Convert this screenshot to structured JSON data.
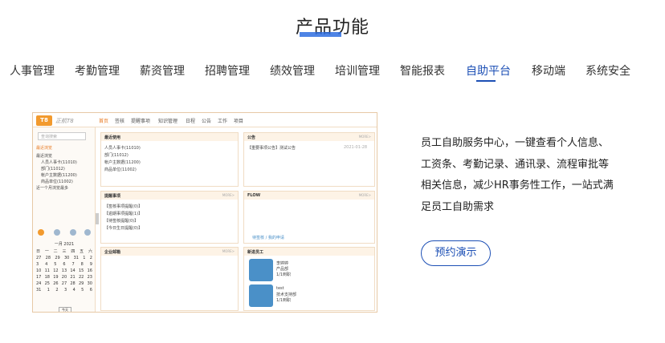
{
  "section_title": "产品功能",
  "tabs": [
    {
      "label": "人事管理",
      "active": false
    },
    {
      "label": "考勤管理",
      "active": false
    },
    {
      "label": "薪资管理",
      "active": false
    },
    {
      "label": "招聘管理",
      "active": false
    },
    {
      "label": "绩效管理",
      "active": false
    },
    {
      "label": "培训管理",
      "active": false
    },
    {
      "label": "智能报表",
      "active": false
    },
    {
      "label": "自助平台",
      "active": true
    },
    {
      "label": "移动端",
      "active": false
    },
    {
      "label": "系统安全",
      "active": false
    }
  ],
  "screenshot": {
    "logo": "T8",
    "brand": "正航T8",
    "nav": [
      "首页",
      "签核",
      "提醒事项",
      "知识管理",
      "日程",
      "公告",
      "工作",
      "项目"
    ],
    "search_placeholder": "查询搜索",
    "side_lines": [
      "最近浏览",
      "最近浏览",
      "人员人事卡(11010)",
      "部门(11012)",
      "帐户主数据(11200)",
      "商品单位(11002)",
      "近一个月浏览最多"
    ],
    "calendar": {
      "header": "一月 2021",
      "weekdays": [
        "日",
        "一",
        "二",
        "三",
        "四",
        "五",
        "六"
      ],
      "rows": [
        [
          "27",
          "28",
          "29",
          "30",
          "31",
          "1",
          "2"
        ],
        [
          "3",
          "4",
          "5",
          "6",
          "7",
          "8",
          "9"
        ],
        [
          "10",
          "11",
          "12",
          "13",
          "14",
          "15",
          "16"
        ],
        [
          "17",
          "18",
          "19",
          "20",
          "21",
          "22",
          "23"
        ],
        [
          "24",
          "25",
          "26",
          "27",
          "28",
          "29",
          "30"
        ],
        [
          "31",
          "1",
          "2",
          "3",
          "4",
          "5",
          "6"
        ]
      ],
      "today_button": "今天"
    },
    "panels": {
      "recent": {
        "title": "最近使用",
        "lines": [
          "人员人事卡(11010)",
          "部门(11012)",
          "帐户主数据(11200)",
          "商品单位(11002)"
        ]
      },
      "notice": {
        "title": "公告",
        "more": "MORE>",
        "line": "【重要事项公告】测试公告",
        "date": "2021-01-28"
      },
      "remind": {
        "title": "提醒事项",
        "more": "MORE>",
        "lines": [
          "【签核事项提醒(0)】",
          "【逾期事项提醒(1)】",
          "【待签核提醒(0)】",
          "【今日生日提醒(0)】"
        ]
      },
      "flow": {
        "title": "FLOW",
        "more": "MORE>",
        "footer": "待签核 / 我的申请"
      },
      "mail": {
        "title": "企业邮箱",
        "more": "MORE>"
      },
      "newemp": {
        "title": "新进员工",
        "emps": [
          [
            "李婷婷",
            "产品部",
            "1/1到职"
          ],
          [
            "test",
            "技术支持部",
            "1/1到职"
          ]
        ]
      }
    }
  },
  "description": "员工自助服务中心，一键查看个人信息、工资条、考勤记录、通讯录、流程审批等相关信息，减少HR事务性工作，一站式满足员工自助需求",
  "cta_label": "预约演示",
  "colors": {
    "accent": "#1c4fb5",
    "title_bar": "#2f6fe0",
    "app_orange": "#f29a2e"
  }
}
